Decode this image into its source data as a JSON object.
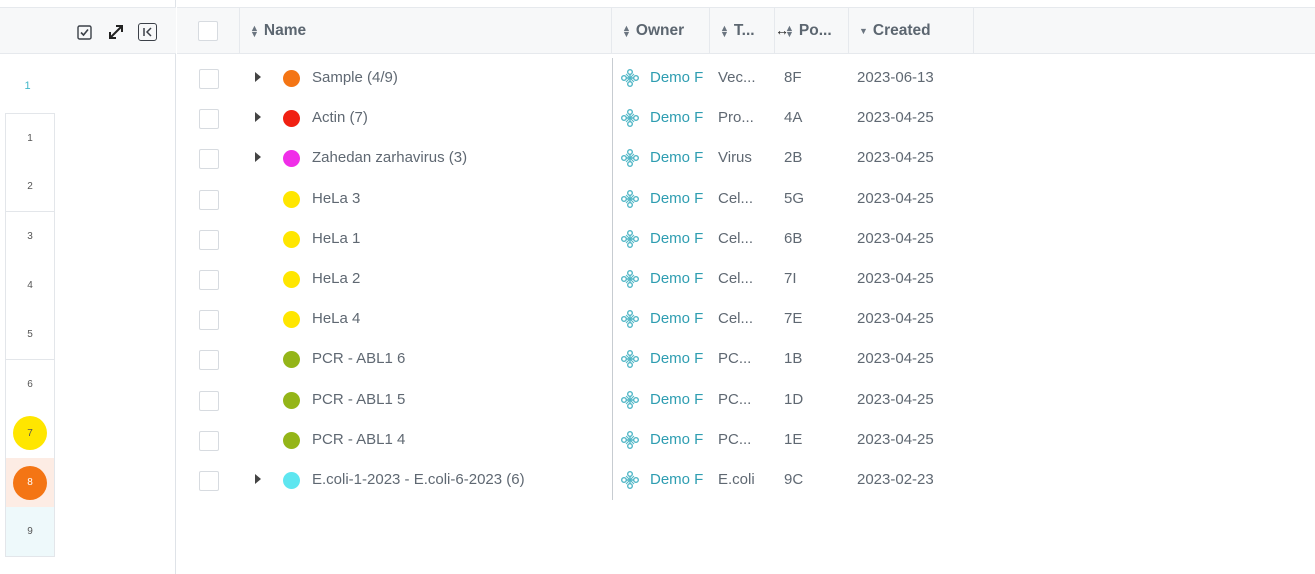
{
  "toolbar": {
    "select_icon": "checkbox-icon",
    "expand_icon": "expand-icon",
    "collapse_icon": "collapse-panel-icon",
    "collapse_glyph": "K"
  },
  "grid": {
    "column_label": "1",
    "cells": [
      {
        "label": "1",
        "well_color": ""
      },
      {
        "label": "2",
        "well_color": ""
      },
      {
        "label": "3",
        "well_color": ""
      },
      {
        "label": "4",
        "well_color": ""
      },
      {
        "label": "5",
        "well_color": ""
      },
      {
        "label": "6",
        "well_color": ""
      },
      {
        "label": "7",
        "well_color": "#ffe600"
      },
      {
        "label": "8",
        "well_color": "#f47514"
      },
      {
        "label": "9",
        "well_color": ""
      }
    ]
  },
  "columns": {
    "name": "Name",
    "owner": "Owner",
    "type": "T...",
    "position": "Po...",
    "created": "Created"
  },
  "rows": [
    {
      "name": "Sample  (4/9)",
      "color": "#f47514",
      "expandable": true,
      "owner": "Demo F",
      "type": "Vec...",
      "position": "8F",
      "created": "2023-06-13"
    },
    {
      "name": "Actin  (7)",
      "color": "#f02012",
      "expandable": true,
      "owner": "Demo F",
      "type": "Pro...",
      "position": "4A",
      "created": "2023-04-25"
    },
    {
      "name": "Zahedan zarhavirus  (3)",
      "color": "#f02ee8",
      "expandable": true,
      "owner": "Demo F",
      "type": "Virus",
      "position": "2B",
      "created": "2023-04-25"
    },
    {
      "name": "HeLa 3",
      "color": "#ffe600",
      "expandable": false,
      "owner": "Demo F",
      "type": "Cel...",
      "position": "5G",
      "created": "2023-04-25"
    },
    {
      "name": "HeLa 1",
      "color": "#ffe600",
      "expandable": false,
      "owner": "Demo F",
      "type": "Cel...",
      "position": "6B",
      "created": "2023-04-25"
    },
    {
      "name": "HeLa 2",
      "color": "#ffe600",
      "expandable": false,
      "owner": "Demo F",
      "type": "Cel...",
      "position": "7I",
      "created": "2023-04-25"
    },
    {
      "name": "HeLa 4",
      "color": "#ffe600",
      "expandable": false,
      "owner": "Demo F",
      "type": "Cel...",
      "position": "7E",
      "created": "2023-04-25"
    },
    {
      "name": "PCR - ABL1 6",
      "color": "#94b518",
      "expandable": false,
      "owner": "Demo F",
      "type": "PC...",
      "position": "1B",
      "created": "2023-04-25"
    },
    {
      "name": "PCR - ABL1 5",
      "color": "#94b518",
      "expandable": false,
      "owner": "Demo F",
      "type": "PC...",
      "position": "1D",
      "created": "2023-04-25"
    },
    {
      "name": "PCR - ABL1 4",
      "color": "#94b518",
      "expandable": false,
      "owner": "Demo F",
      "type": "PC...",
      "position": "1E",
      "created": "2023-04-25"
    },
    {
      "name": "E.coli-1-2023 - E.coli-6-2023  (6)",
      "color": "#5ee6f0",
      "expandable": true,
      "owner": "Demo F",
      "type": "E.coli",
      "position": "9C",
      "created": "2023-02-23"
    }
  ]
}
